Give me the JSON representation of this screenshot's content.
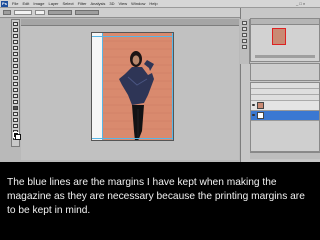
{
  "menubar": {
    "app_logo": "Ps",
    "items": [
      "File",
      "Edit",
      "Image",
      "Layer",
      "Select",
      "Filter",
      "Analysis",
      "3D",
      "View",
      "Window",
      "Help"
    ],
    "workspace_label": "ESSENTIALS",
    "window_controls": "_ □ ×"
  },
  "slide": {
    "caption": "The blue lines are the margins I have kept when making the magazine as they are necessary because the printing margins are to be kept in mind."
  },
  "colors": {
    "background": "#000000",
    "caption_text": "#f2f2f2",
    "guide": "#59b6e6",
    "selected_layer": "#3a78d2",
    "wall": "#d98a6e"
  },
  "icons": [
    "move-tool-icon",
    "marquee-tool-icon",
    "lasso-tool-icon",
    "crop-tool-icon",
    "brush-tool-icon",
    "eraser-tool-icon",
    "type-tool-icon",
    "hand-tool-icon",
    "zoom-tool-icon",
    "eye-icon"
  ]
}
